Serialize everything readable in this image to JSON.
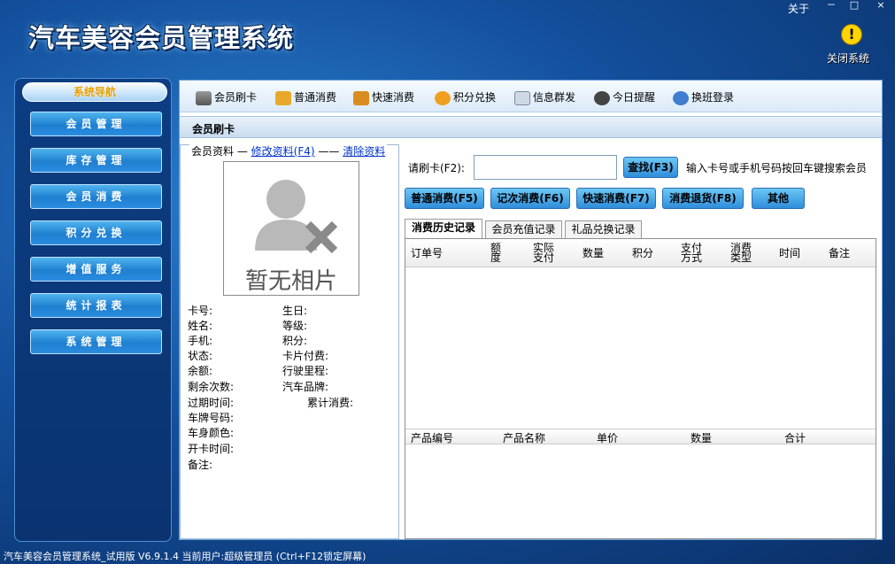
{
  "app": {
    "title": "汽车美容会员管理系统",
    "about": "关于",
    "close_system": "关闭系统"
  },
  "window_controls": {
    "minimize": "－",
    "maximize": "□",
    "close": "×"
  },
  "sidebar": {
    "title": "系统导航",
    "items": [
      "会员管理",
      "库存管理",
      "会员消费",
      "积分兑换",
      "增值服务",
      "统计报表",
      "系统管理"
    ]
  },
  "toolbar": {
    "items": [
      {
        "label": "会员刷卡",
        "icon": "card-reader-icon"
      },
      {
        "label": "普通消费",
        "icon": "money-icon"
      },
      {
        "label": "快速消费",
        "icon": "coins-icon"
      },
      {
        "label": "积分兑换",
        "icon": "exchange-icon"
      },
      {
        "label": "信息群发",
        "icon": "envelope-icon"
      },
      {
        "label": "今日提醒",
        "icon": "clock-icon"
      },
      {
        "label": "换班登录",
        "icon": "login-icon"
      }
    ]
  },
  "section": {
    "title": "会员刷卡"
  },
  "member_panel": {
    "legend": "会员资料",
    "edit_link": "修改资料(F4)",
    "clear_link": "清除资料",
    "photo_placeholder": "暂无相片",
    "fields_left": [
      "卡号:",
      "姓名:",
      "手机:",
      "状态:",
      "余额:",
      "剩余次数:",
      "过期时间:",
      "车牌号码:",
      "车身颜色:",
      "开卡时间:",
      "备注:"
    ],
    "fields_right": [
      "生日:",
      "等级:",
      "积分:",
      "卡片付费:",
      "行驶里程:",
      "汽车品牌:",
      "累计消费:"
    ]
  },
  "search": {
    "card_label": "请刷卡(F2):",
    "card_value": "",
    "find_button": "查找(F3)",
    "hint": "输入卡号或手机号码按回车键搜索会员"
  },
  "actions": [
    "普通消费(F5)",
    "记次消费(F6)",
    "快速消费(F7)",
    "消费退货(F8)",
    "其他"
  ],
  "tabs": [
    "消费历史记录",
    "会员充值记录",
    "礼品兑换记录"
  ],
  "history_columns": [
    "订单号",
    "额\n度",
    "实际\n支付",
    "数量",
    "积分",
    "支付\n方式",
    "消费\n类型",
    "时间",
    "备注"
  ],
  "product_columns": [
    "产品编号",
    "产品名称",
    "单价",
    "数量",
    "合计"
  ],
  "status": {
    "text": "汽车美容会员管理系统_试用版 V6.9.1.4 当前用户:超级管理员 (Ctrl+F12锁定屏幕)"
  },
  "colors": {
    "nav_button": "#2f8ddb",
    "accent": "#ffd400",
    "background": "#134f9c"
  }
}
